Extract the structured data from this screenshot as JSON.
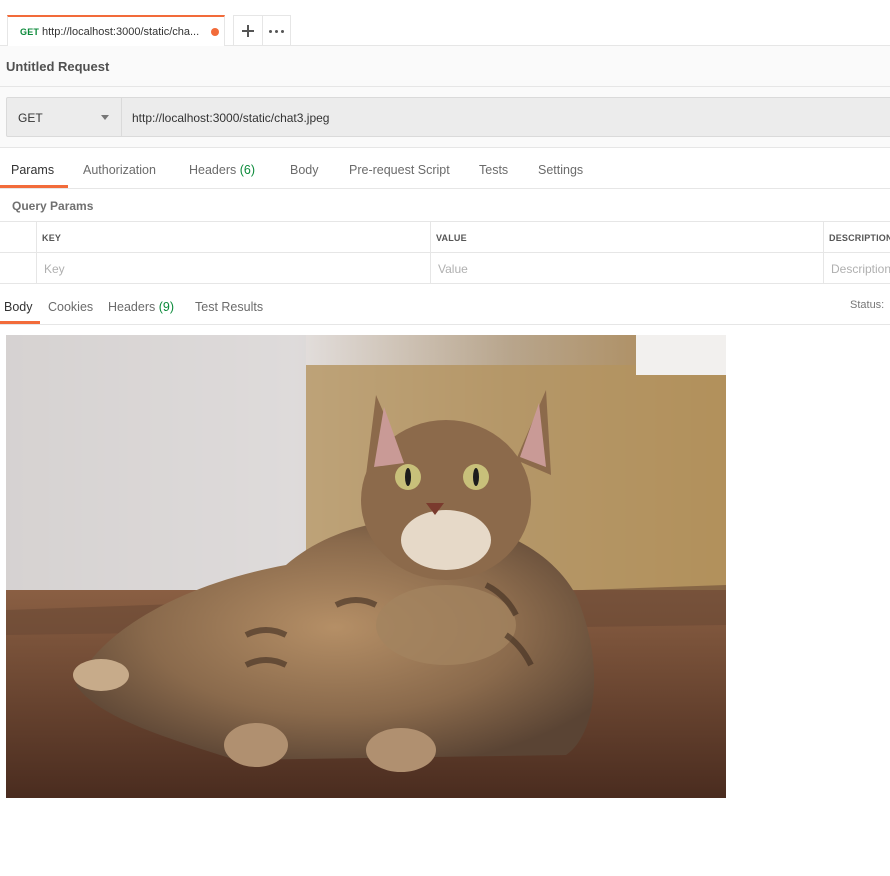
{
  "tab": {
    "method": "GET",
    "title": "http://localhost:3000/static/cha...",
    "unsaved": true
  },
  "tab_actions": {
    "new_tab_icon": "plus-icon",
    "more_icon": "more-icon"
  },
  "request": {
    "title": "Untitled Request",
    "method": "GET",
    "url": "http://localhost:3000/static/chat3.jpeg"
  },
  "request_tabs": {
    "params": "Params",
    "authorization": "Authorization",
    "headers": "Headers",
    "headers_count": "(6)",
    "body": "Body",
    "pre_request_script": "Pre-request Script",
    "tests": "Tests",
    "settings": "Settings"
  },
  "query_params": {
    "label": "Query Params",
    "columns": [
      "KEY",
      "VALUE",
      "DESCRIPTION"
    ],
    "placeholders": [
      "Key",
      "Value",
      "Description"
    ]
  },
  "response_tabs": {
    "body": "Body",
    "cookies": "Cookies",
    "headers": "Headers",
    "headers_count": "(9)",
    "test_results": "Test Results",
    "status_label": "Status:"
  },
  "colors": {
    "accent": "#f26b3a",
    "method_green": "#0b8a3a"
  },
  "preview": {
    "subject": "cat-photo"
  }
}
